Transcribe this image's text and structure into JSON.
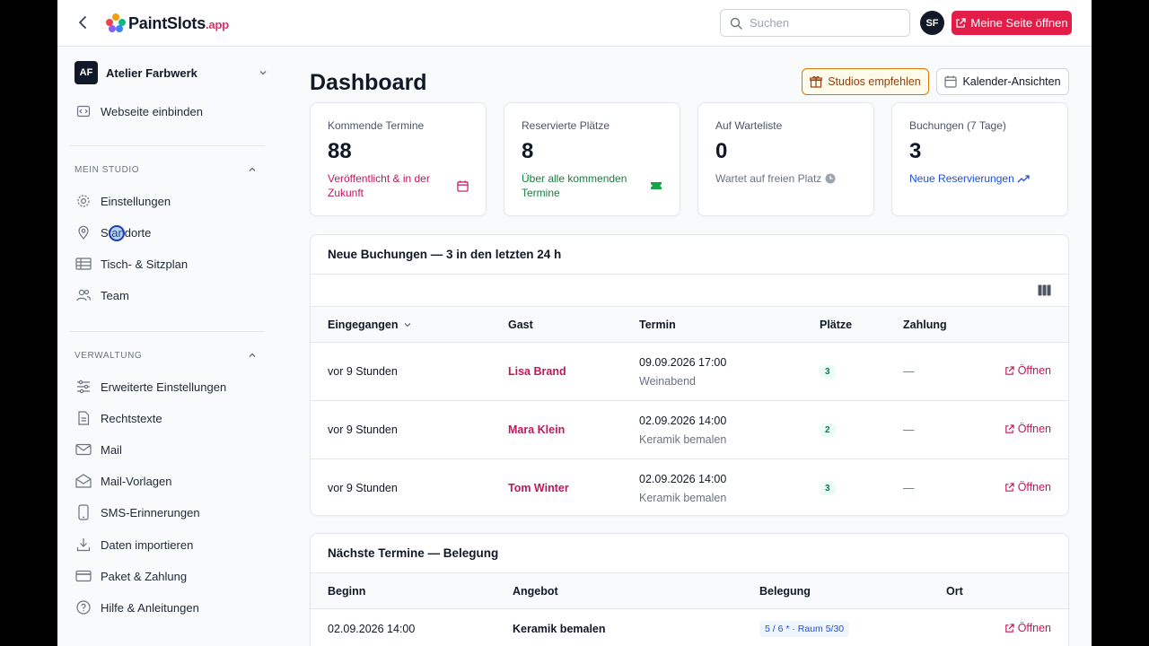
{
  "topbar": {
    "logo_brand": "PaintSlots",
    "logo_suffix": ".app",
    "search_placeholder": "Suchen",
    "avatar_initials": "SF",
    "open_page_label": "Meine Seite öffnen"
  },
  "sidebar": {
    "studio_initials": "AF",
    "studio_name": "Atelier Farbwerk",
    "embed_label": "Webseite einbinden",
    "section_studio": "MEIN STUDIO",
    "studio_items": [
      "Einstellungen",
      "Standorte",
      "Tisch- & Sitzplan",
      "Team"
    ],
    "section_admin": "VERWALTUNG",
    "admin_items": [
      "Erweiterte Einstellungen",
      "Rechtstexte",
      "Mail",
      "Mail-Vorlagen",
      "SMS-Erinnerungen",
      "Daten importieren",
      "Paket & Zahlung",
      "Hilfe & Anleitungen"
    ]
  },
  "main": {
    "title": "Dashboard",
    "recommend_label": "Studios empfehlen",
    "calendar_label": "Kalender-Ansichten",
    "stats": [
      {
        "label": "Kommende Termine",
        "value": "88",
        "sub": "Veröffentlicht & in der Zukunft",
        "color": "#be185d"
      },
      {
        "label": "Reservierte Plätze",
        "value": "8",
        "sub": "Über alle kommenden Termine",
        "color": "#15803d"
      },
      {
        "label": "Auf Warteliste",
        "value": "0",
        "sub": "Wartet auf freien Platz",
        "color": "#6b7280"
      },
      {
        "label": "Buchungen (7 Tage)",
        "value": "3",
        "sub": "Neue Reservierungen",
        "color": "#1d4ed8"
      }
    ],
    "bookings": {
      "title": "Neue Buchungen — 3 in den letzten 24 h",
      "columns": [
        "Eingegangen",
        "Gast",
        "Termin",
        "Plätze",
        "Zahlung"
      ],
      "open_label": "Öffnen",
      "rows": [
        {
          "received": "vor 9 Stunden",
          "guest": "Lisa Brand",
          "date": "09.09.2026 17:00",
          "offer": "Weinabend",
          "seats": "3",
          "payment": "—"
        },
        {
          "received": "vor 9 Stunden",
          "guest": "Mara Klein",
          "date": "02.09.2026 14:00",
          "offer": "Keramik bemalen",
          "seats": "2",
          "payment": "—"
        },
        {
          "received": "vor 9 Stunden",
          "guest": "Tom Winter",
          "date": "02.09.2026 14:00",
          "offer": "Keramik bemalen",
          "seats": "3",
          "payment": "—"
        }
      ]
    },
    "next": {
      "title": "Nächste Termine — Belegung",
      "columns": [
        "Beginn",
        "Angebot",
        "Belegung",
        "Ort"
      ],
      "rows": [
        {
          "start": "02.09.2026 14:00",
          "offer": "Keramik bemalen",
          "occupancy": "5 / 6 * · Raum 5/30",
          "open": "Öffnen"
        }
      ]
    }
  }
}
